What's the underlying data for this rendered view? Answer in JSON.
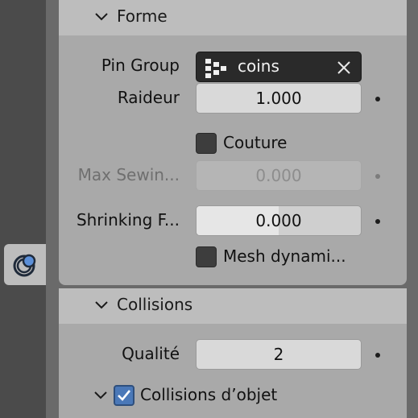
{
  "sections": {
    "forme": {
      "title": "Forme"
    },
    "collisions": {
      "title": "Collisions"
    }
  },
  "forme": {
    "pin_group": {
      "label": "Pin Group",
      "value": "coins",
      "icon": "vertex-group-icon",
      "clear_icon": "close-icon"
    },
    "raideur": {
      "label": "Raideur",
      "value": "1.000"
    },
    "couture": {
      "label": "Couture",
      "checked": false
    },
    "max_sewing": {
      "label": "Max Sewin...",
      "value": "0.000",
      "disabled": true
    },
    "shrinking": {
      "label": "Shrinking F...",
      "value": "0.000",
      "fill_fraction": 0.5
    },
    "mesh_dynamic": {
      "label": "Mesh dynami...",
      "checked": false
    }
  },
  "collisions": {
    "qualite": {
      "label": "Qualité",
      "value": "2"
    },
    "collisions_objet": {
      "label": "Collisions d’objet",
      "checked": true
    }
  },
  "colors": {
    "header_bg": "#bdbdbd",
    "panel_bg": "#a9a9a9",
    "field_bg": "#d9d9d9",
    "checkbox_on": "#4a78b8"
  }
}
